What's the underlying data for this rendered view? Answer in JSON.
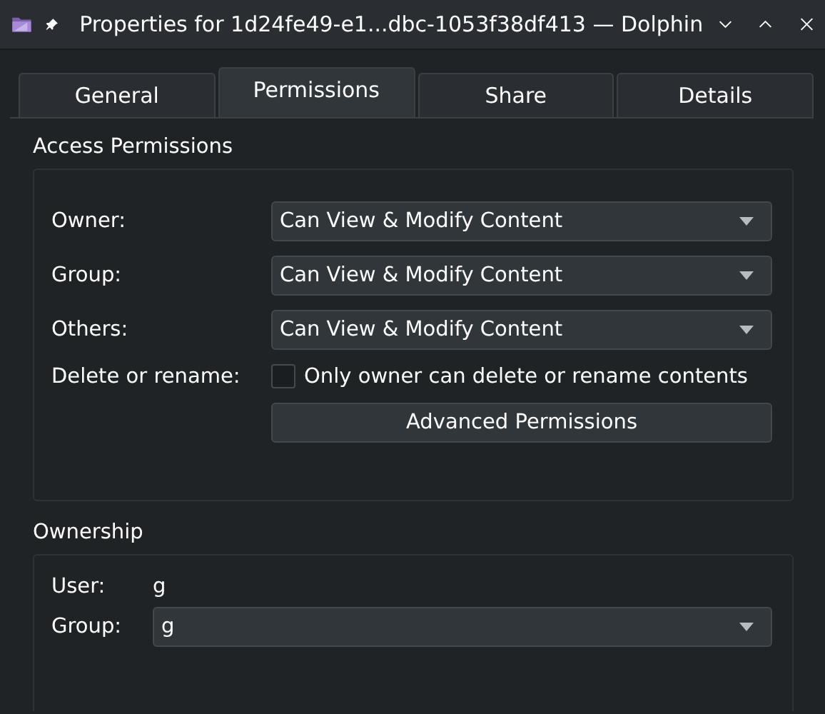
{
  "window": {
    "title": "Properties for 1d24fe49-e1...dbc-1053f38df413 — Dolphin",
    "pinned": true
  },
  "tabs": [
    {
      "label": "General",
      "selected": false
    },
    {
      "label": "Permissions",
      "selected": true
    },
    {
      "label": "Share",
      "selected": false
    },
    {
      "label": "Details",
      "selected": false
    }
  ],
  "access_permissions": {
    "title": "Access Permissions",
    "rows": [
      {
        "label": "Owner:",
        "value": "Can View & Modify Content"
      },
      {
        "label": "Group:",
        "value": "Can View & Modify Content"
      },
      {
        "label": "Others:",
        "value": "Can View & Modify Content"
      }
    ],
    "delete_rename": {
      "label": "Delete or rename:",
      "checkbox": "Only owner can delete or rename contents",
      "checked": false
    },
    "advanced_button": "Advanced Permissions"
  },
  "ownership": {
    "title": "Ownership",
    "user_label": "User:",
    "user": "g",
    "group_label": "Group:",
    "group": "g"
  }
}
